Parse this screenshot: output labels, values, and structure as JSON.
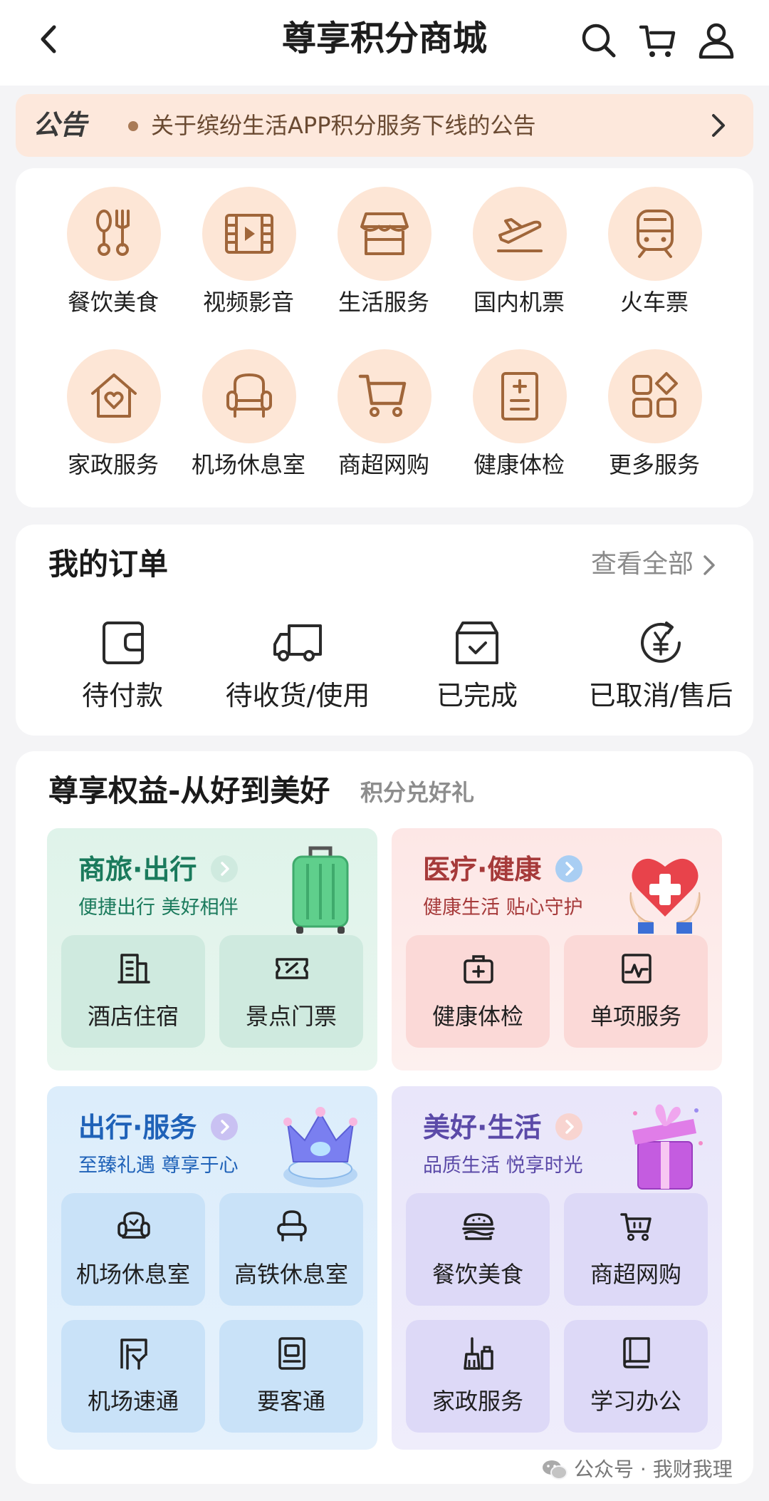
{
  "header": {
    "title": "尊享积分商城"
  },
  "notice": {
    "tag": "公告",
    "text": "关于缤纷生活APP积分服务下线的公告"
  },
  "services": [
    {
      "label": "餐饮美食",
      "icon": "dining-icon"
    },
    {
      "label": "视频影音",
      "icon": "film-icon"
    },
    {
      "label": "生活服务",
      "icon": "shop-icon"
    },
    {
      "label": "国内机票",
      "icon": "airplane-icon"
    },
    {
      "label": "火车票",
      "icon": "train-icon"
    },
    {
      "label": "家政服务",
      "icon": "home-heart-icon"
    },
    {
      "label": "机场休息室",
      "icon": "armchair-icon"
    },
    {
      "label": "商超网购",
      "icon": "cart-icon"
    },
    {
      "label": "健康体检",
      "icon": "clipboard-icon"
    },
    {
      "label": "更多服务",
      "icon": "grid-icon"
    }
  ],
  "orders": {
    "title": "我的订单",
    "view_all": "查看全部",
    "items": [
      {
        "label": "待付款",
        "icon": "wallet-icon"
      },
      {
        "label": "待收货/使用",
        "icon": "truck-icon"
      },
      {
        "label": "已完成",
        "icon": "box-check-icon"
      },
      {
        "label": "已取消/售后",
        "icon": "yen-refund-icon"
      }
    ]
  },
  "benefits": {
    "title": "尊享权益-从好到美好",
    "subtitle": "积分兑好礼",
    "panels": [
      {
        "title": "商旅·出行",
        "subtitle": "便捷出行 美好相伴",
        "accent": "#1a7a5c",
        "tiles": [
          {
            "label": "酒店住宿",
            "icon": "hotel-icon"
          },
          {
            "label": "景点门票",
            "icon": "ticket-icon"
          }
        ]
      },
      {
        "title": "医疗·健康",
        "subtitle": "健康生活 贴心守护",
        "accent": "#a63a3a",
        "tiles": [
          {
            "label": "健康体检",
            "icon": "medkit-icon"
          },
          {
            "label": "单项服务",
            "icon": "pulse-icon"
          }
        ]
      },
      {
        "title": "出行·服务",
        "subtitle": "至臻礼遇 尊享于心",
        "accent": "#1f62b8",
        "tiles": [
          {
            "label": "机场休息室",
            "icon": "lounge-icon"
          },
          {
            "label": "高铁休息室",
            "icon": "seat-icon"
          },
          {
            "label": "机场速通",
            "icon": "gate-icon"
          },
          {
            "label": "要客通",
            "icon": "vip-icon"
          }
        ]
      },
      {
        "title": "美好·生活",
        "subtitle": "品质生活 悦享时光",
        "accent": "#5b4aa8",
        "tiles": [
          {
            "label": "餐饮美食",
            "icon": "burger-icon"
          },
          {
            "label": "商超网购",
            "icon": "cart-icon"
          },
          {
            "label": "家政服务",
            "icon": "broom-icon"
          },
          {
            "label": "学习办公",
            "icon": "book-icon"
          }
        ]
      }
    ]
  },
  "watermark": "公众号 · 我财我理",
  "colors": {
    "icon_brown": "#a0663a",
    "icon_bg": "#fde6d6",
    "notice_bg": "#fde8dc"
  }
}
